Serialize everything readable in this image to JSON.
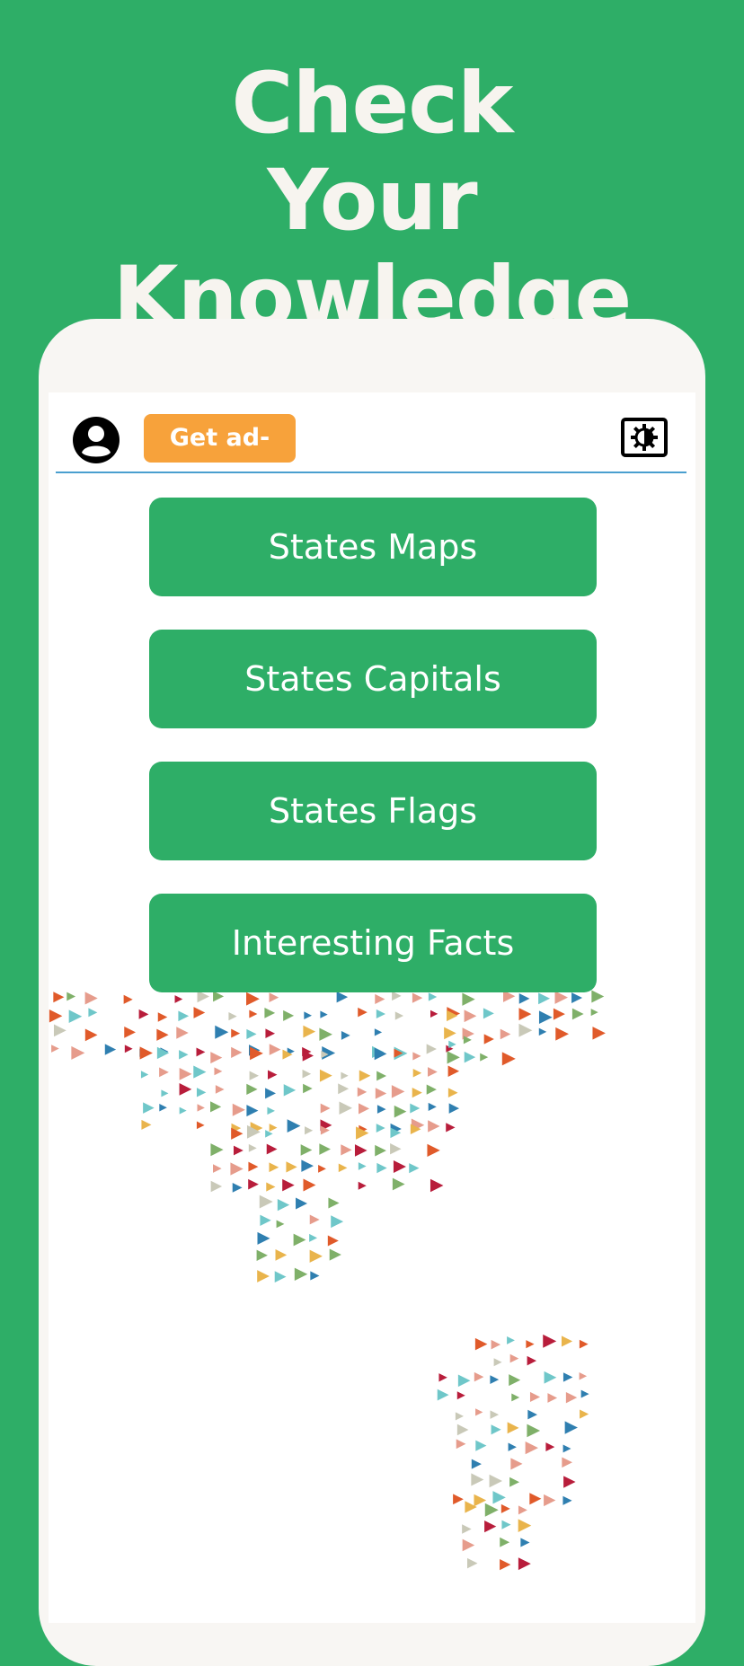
{
  "headline": {
    "line1": "Check",
    "line2": "Your Knowledge"
  },
  "topbar": {
    "profile_icon": "account-circle-icon",
    "ad_free_label": "Get ad-free",
    "theme_icon": "brightness-toggle-icon"
  },
  "menu": {
    "items": [
      {
        "label": "States Maps"
      },
      {
        "label": "States Capitals"
      },
      {
        "label": "States Flags"
      },
      {
        "label": "Interesting Facts"
      }
    ]
  },
  "colors": {
    "brand_green": "#2eae67",
    "ad_free_orange": "#f7a23b",
    "divider_blue": "#4a9fcf",
    "pattern": [
      "#e05a2a",
      "#2f7fb0",
      "#7fb069",
      "#e9b44c",
      "#c9c9b8",
      "#e69c8c",
      "#6fc7c9",
      "#b81d3b"
    ]
  },
  "background_art": "triangle-pattern-world-map"
}
